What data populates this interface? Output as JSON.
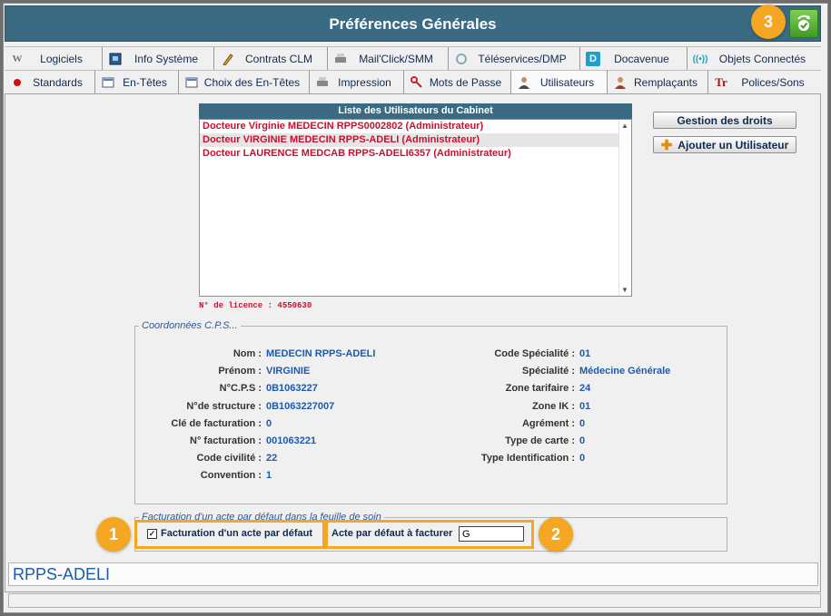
{
  "window": {
    "title": "Préférences Générales"
  },
  "tabs_row1": [
    {
      "label": "Logiciels",
      "icon": "w-icon"
    },
    {
      "label": "Info Système",
      "icon": "computer-icon"
    },
    {
      "label": "Contrats CLM",
      "icon": "pencil-icon"
    },
    {
      "label": "Mail'Click/SMM",
      "icon": "printer-icon"
    },
    {
      "label": "Téléservices/DMP",
      "icon": "refresh-icon"
    },
    {
      "label": "Docavenue",
      "icon": "d-icon"
    },
    {
      "label": "Objets Connectés",
      "icon": "wireless-icon"
    }
  ],
  "tabs_row2": [
    {
      "label": "Standards",
      "icon": "red-dot-icon"
    },
    {
      "label": "En-Têtes",
      "icon": "header-icon"
    },
    {
      "label": "Choix des En-Têtes",
      "icon": "header-icon"
    },
    {
      "label": "Impression",
      "icon": "printer-icon"
    },
    {
      "label": "Mots de Passe",
      "icon": "key-icon"
    },
    {
      "label": "Utilisateurs",
      "icon": "user-icon"
    },
    {
      "label": "Remplaçants",
      "icon": "replacement-user-icon"
    },
    {
      "label": "Polices/Sons",
      "icon": "font-icon"
    }
  ],
  "users": {
    "header": "Liste des Utilisateurs du Cabinet",
    "items": [
      "Docteure Virginie MEDECIN RPPS0002802 (Administrateur)",
      "Docteur VIRGINIE MEDECIN RPPS-ADELI (Administrateur)",
      "Docteur LAURENCE MEDCAB RPPS-ADELI6357 (Administrateur)"
    ],
    "license": "N° de licence : 4550630"
  },
  "buttons": {
    "rights": "Gestion des droits",
    "add_user": "Ajouter un Utilisateur"
  },
  "cps": {
    "legend": "Coordonnées C.P.S...",
    "left": [
      {
        "k": "Nom :",
        "v": "MEDECIN RPPS-ADELI"
      },
      {
        "k": "Prénom :",
        "v": "VIRGINIE"
      },
      {
        "k": "N°C.P.S :",
        "v": "0B1063227"
      },
      {
        "k": "N°de structure :",
        "v": "0B1063227007"
      },
      {
        "k": "Clé de facturation :",
        "v": "0"
      },
      {
        "k": "N° facturation :",
        "v": "001063221"
      },
      {
        "k": "Code civilité :",
        "v": "22"
      },
      {
        "k": "Convention :",
        "v": "1"
      }
    ],
    "right": [
      {
        "k": "Code Spécialité :",
        "v": "01"
      },
      {
        "k": "Spécialité :",
        "v": "Médecine Générale"
      },
      {
        "k": "Zone tarifaire :",
        "v": "24"
      },
      {
        "k": "Zone IK :",
        "v": "01"
      },
      {
        "k": "Agrément :",
        "v": "0"
      },
      {
        "k": "Type de carte :",
        "v": "0"
      },
      {
        "k": "Type Identification :",
        "v": "0"
      }
    ]
  },
  "billing": {
    "legend": "Facturation d'un acte par défaut dans la feuille de soin",
    "checkbox_label": "Facturation d'un acte par défaut",
    "checkbox_checked": true,
    "act_label": "Acte par défaut à facturer",
    "act_value": "G"
  },
  "badges": [
    "1",
    "2",
    "3"
  ],
  "status": {
    "text": "RPPS-ADELI"
  },
  "colors": {
    "accent": "#f5a623",
    "title_bar": "#3a6b82",
    "user_text": "#c8102e",
    "value_text": "#1f5aa6"
  }
}
